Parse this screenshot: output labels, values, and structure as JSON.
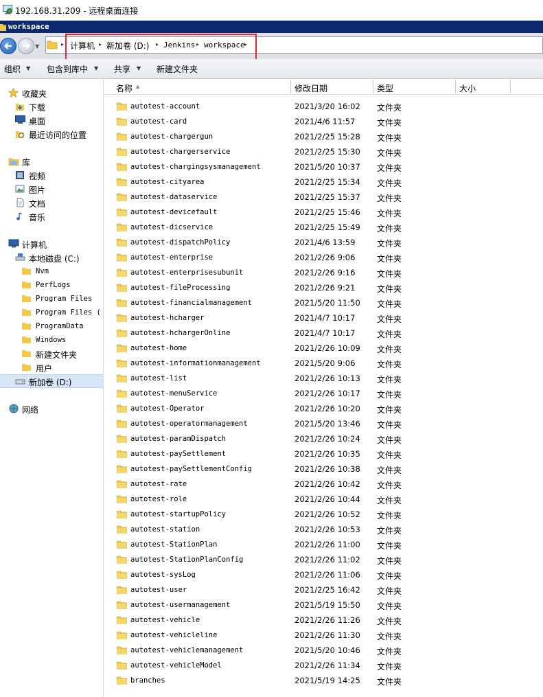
{
  "window": {
    "rdp_title": "192.168.31.209 - 远程桌面连接",
    "explorer_title": "workspace"
  },
  "address": {
    "crumbs": [
      "计算机",
      "新加卷 (D:)",
      "Jenkins",
      "workspace"
    ]
  },
  "toolbar": {
    "organize": "组织",
    "include_in_library": "包含到库中",
    "share": "共享",
    "new_folder": "新建文件夹"
  },
  "nav": {
    "favorites": "收藏夹",
    "downloads": "下载",
    "desktop": "桌面",
    "recent": "最近访问的位置",
    "libraries": "库",
    "videos": "视频",
    "pictures": "图片",
    "documents": "文档",
    "music": "音乐",
    "computer": "计算机",
    "local_disk": "本地磁盘 (C:)",
    "c_folders": [
      "Nvm",
      "PerfLogs",
      "Program Files",
      "Program Files (x",
      "ProgramData",
      "Windows",
      "新建文件夹",
      "用户"
    ],
    "new_volume": "新加卷 (D:)",
    "network": "网络"
  },
  "columns": {
    "name": "名称",
    "modified": "修改日期",
    "type": "类型",
    "size": "大小"
  },
  "files": [
    {
      "name": "autotest-account",
      "date": "2021/3/20 16:02",
      "type": "文件夹"
    },
    {
      "name": "autotest-card",
      "date": "2021/4/6 11:57",
      "type": "文件夹"
    },
    {
      "name": "autotest-chargergun",
      "date": "2021/2/25 15:28",
      "type": "文件夹"
    },
    {
      "name": "autotest-chargerservice",
      "date": "2021/2/25 15:30",
      "type": "文件夹"
    },
    {
      "name": "autotest-chargingsysmanagement",
      "date": "2021/5/20 10:37",
      "type": "文件夹"
    },
    {
      "name": "autotest-cityarea",
      "date": "2021/2/25 15:34",
      "type": "文件夹"
    },
    {
      "name": "autotest-dataservice",
      "date": "2021/2/25 15:37",
      "type": "文件夹"
    },
    {
      "name": "autotest-devicefault",
      "date": "2021/2/25 15:46",
      "type": "文件夹"
    },
    {
      "name": "autotest-dicservice",
      "date": "2021/2/25 15:49",
      "type": "文件夹"
    },
    {
      "name": "autotest-dispatchPolicy",
      "date": "2021/4/6 13:59",
      "type": "文件夹"
    },
    {
      "name": "autotest-enterprise",
      "date": "2021/2/26 9:06",
      "type": "文件夹"
    },
    {
      "name": "autotest-enterprisesubunit",
      "date": "2021/2/26 9:16",
      "type": "文件夹"
    },
    {
      "name": "autotest-fileProcessing",
      "date": "2021/2/26 9:21",
      "type": "文件夹"
    },
    {
      "name": "autotest-financialmanagement",
      "date": "2021/5/20 11:50",
      "type": "文件夹"
    },
    {
      "name": "autotest-hcharger",
      "date": "2021/4/7 10:17",
      "type": "文件夹"
    },
    {
      "name": "autotest-hchargerOnline",
      "date": "2021/4/7 10:17",
      "type": "文件夹"
    },
    {
      "name": "autotest-home",
      "date": "2021/2/26 10:09",
      "type": "文件夹"
    },
    {
      "name": "autotest-informationmanagement",
      "date": "2021/5/20 9:06",
      "type": "文件夹"
    },
    {
      "name": "autotest-list",
      "date": "2021/2/26 10:13",
      "type": "文件夹"
    },
    {
      "name": "autotest-menuService",
      "date": "2021/2/26 10:17",
      "type": "文件夹"
    },
    {
      "name": "autotest-Operator",
      "date": "2021/2/26 10:20",
      "type": "文件夹"
    },
    {
      "name": "autotest-operatormanagement",
      "date": "2021/5/20 13:46",
      "type": "文件夹"
    },
    {
      "name": "autotest-paramDispatch",
      "date": "2021/2/26 10:24",
      "type": "文件夹"
    },
    {
      "name": "autotest-paySettlement",
      "date": "2021/2/26 10:35",
      "type": "文件夹"
    },
    {
      "name": "autotest-paySettlementConfig",
      "date": "2021/2/26 10:38",
      "type": "文件夹"
    },
    {
      "name": "autotest-rate",
      "date": "2021/2/26 10:42",
      "type": "文件夹"
    },
    {
      "name": "autotest-role",
      "date": "2021/2/26 10:44",
      "type": "文件夹"
    },
    {
      "name": "autotest-startupPolicy",
      "date": "2021/2/26 10:52",
      "type": "文件夹"
    },
    {
      "name": "autotest-station",
      "date": "2021/2/26 10:53",
      "type": "文件夹"
    },
    {
      "name": "autotest-StationPlan",
      "date": "2021/2/26 11:00",
      "type": "文件夹"
    },
    {
      "name": "autotest-StationPlanConfig",
      "date": "2021/2/26 11:02",
      "type": "文件夹"
    },
    {
      "name": "autotest-sysLog",
      "date": "2021/2/26 11:06",
      "type": "文件夹"
    },
    {
      "name": "autotest-user",
      "date": "2021/2/25 16:42",
      "type": "文件夹"
    },
    {
      "name": "autotest-usermanagement",
      "date": "2021/5/19 15:50",
      "type": "文件夹"
    },
    {
      "name": "autotest-vehicle",
      "date": "2021/2/26 11:26",
      "type": "文件夹"
    },
    {
      "name": "autotest-vehicleline",
      "date": "2021/2/26 11:30",
      "type": "文件夹"
    },
    {
      "name": "autotest-vehiclemanagement",
      "date": "2021/5/20 10:46",
      "type": "文件夹"
    },
    {
      "name": "autotest-vehicleModel",
      "date": "2021/2/26 11:34",
      "type": "文件夹"
    },
    {
      "name": "branches",
      "date": "2021/5/19 14:25",
      "type": "文件夹"
    }
  ],
  "colors": {
    "window_title_bg": "#0b2a6f",
    "highlight_box": "#e8232c",
    "selected_nav": "#d6e6f7",
    "folder_yellow": "#f2c84b"
  },
  "icons": {
    "rdp": "remote-desktop-icon",
    "back": "back-arrow-icon",
    "forward": "forward-arrow-icon",
    "folder": "folder-icon",
    "star": "star-icon",
    "drive": "hard-drive-icon",
    "network": "network-icon"
  }
}
